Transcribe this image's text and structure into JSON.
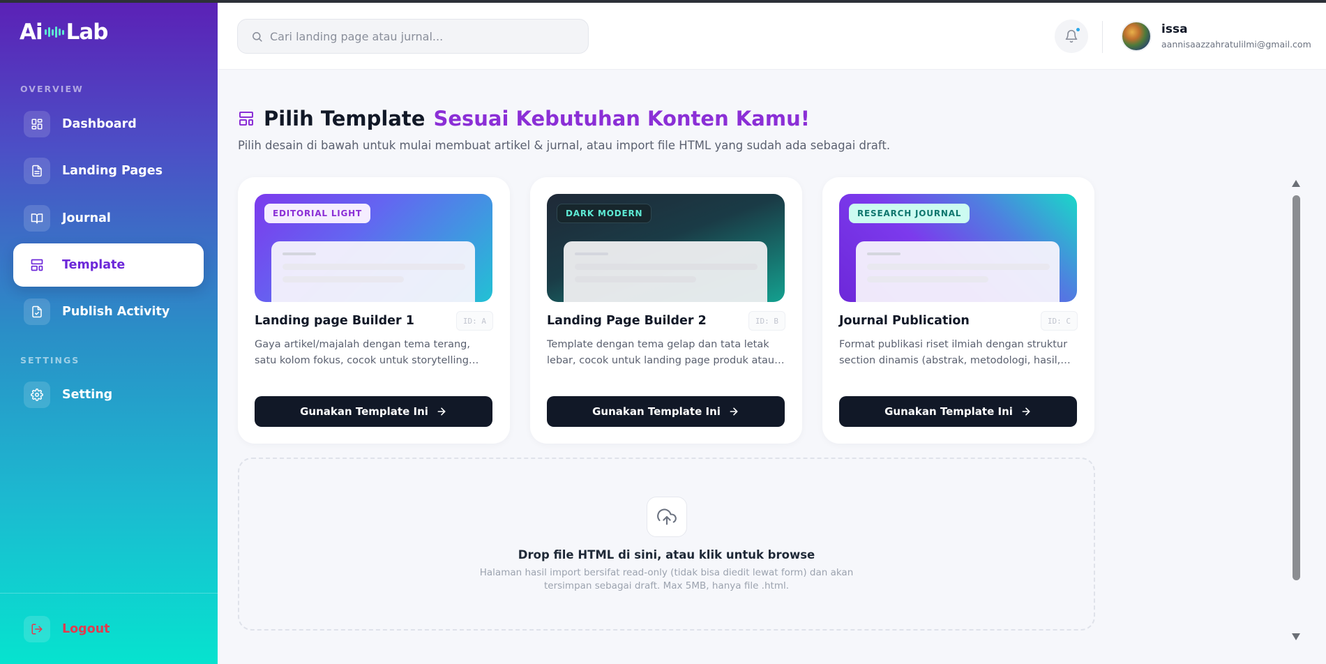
{
  "brand": {
    "logo_left": "Ai",
    "logo_right": "Lab"
  },
  "colors": {
    "accent": "#8b2fd6",
    "sidebar_top": "#5b21b6",
    "sidebar_bottom": "#06e3cf",
    "button_dark": "#111827",
    "logout": "#e23b4e"
  },
  "sidebar": {
    "overview_label": "OVERVIEW",
    "settings_label": "SETTINGS",
    "items": [
      {
        "label": "Dashboard",
        "icon": "dashboard-icon"
      },
      {
        "label": "Landing Pages",
        "icon": "document-icon"
      },
      {
        "label": "Journal",
        "icon": "book-open-icon"
      },
      {
        "label": "Template",
        "icon": "layout-template-icon",
        "active": true
      },
      {
        "label": "Publish Activity",
        "icon": "file-check-icon"
      }
    ],
    "settings_items": [
      {
        "label": "Setting",
        "icon": "gear-icon"
      }
    ],
    "logout_label": "Logout"
  },
  "header": {
    "search_placeholder": "Cari landing page atau jurnal...",
    "user_name": "issa",
    "user_email": "aannisaazzahratulilmi@gmail.com"
  },
  "main": {
    "title": "Pilih Template",
    "title_accent": "Sesuai Kebutuhan Konten Kamu!",
    "subtitle": "Pilih desain di bawah untuk mulai membuat artikel & jurnal, atau import file HTML yang sudah ada sebagai draft.",
    "cards": [
      {
        "tag": "EDITORIAL LIGHT",
        "title": "Landing page Builder 1",
        "id": "ID: A",
        "description": "Gaya artikel/majalah dengan tema terang, satu kolom fokus, cocok untuk storytelling panjang dan visual.",
        "button": "Gunakan Template Ini"
      },
      {
        "tag": "DARK MODERN",
        "title": "Landing Page Builder 2",
        "id": "ID: B",
        "description": "Template dengan tema gelap dan tata letak lebar, cocok untuk landing page produk atau layanan.",
        "button": "Gunakan Template Ini"
      },
      {
        "tag": "RESEARCH JOURNAL",
        "title": "Journal Publication",
        "id": "ID: C",
        "description": "Format publikasi riset ilmiah dengan struktur section dinamis (abstrak, metodologi, hasil, dst), mudah dibaca.",
        "button": "Gunakan Template Ini"
      }
    ],
    "dropzone": {
      "title": "Drop file HTML di sini, atau klik untuk browse",
      "description": "Halaman hasil import bersifat read-only (tidak bisa diedit lewat form) dan akan tersimpan sebagai draft. Max 5MB, hanya file .html."
    }
  }
}
